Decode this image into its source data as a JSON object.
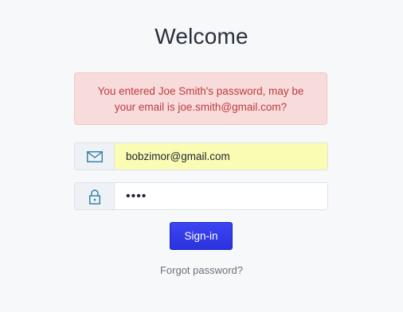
{
  "page": {
    "title": "Welcome"
  },
  "alert": {
    "message": "You entered Joe Smith's password, may be your email is joe.smith@gmail.com?"
  },
  "email_field": {
    "icon": "envelope-icon",
    "value": "bobzimor@gmail.com"
  },
  "password_field": {
    "icon": "padlock-icon",
    "value": "••••"
  },
  "signin_button": {
    "label": "Sign-in"
  },
  "forgot_link": {
    "label": "Forgot password?"
  },
  "colors": {
    "background": "#f6f8fa",
    "alert_bg": "#f8dcdc",
    "alert_text": "#c0393b",
    "autofill_bg": "#fafcb4",
    "button_bg": "#2f38e6",
    "icon_color": "#2d7ea0"
  }
}
